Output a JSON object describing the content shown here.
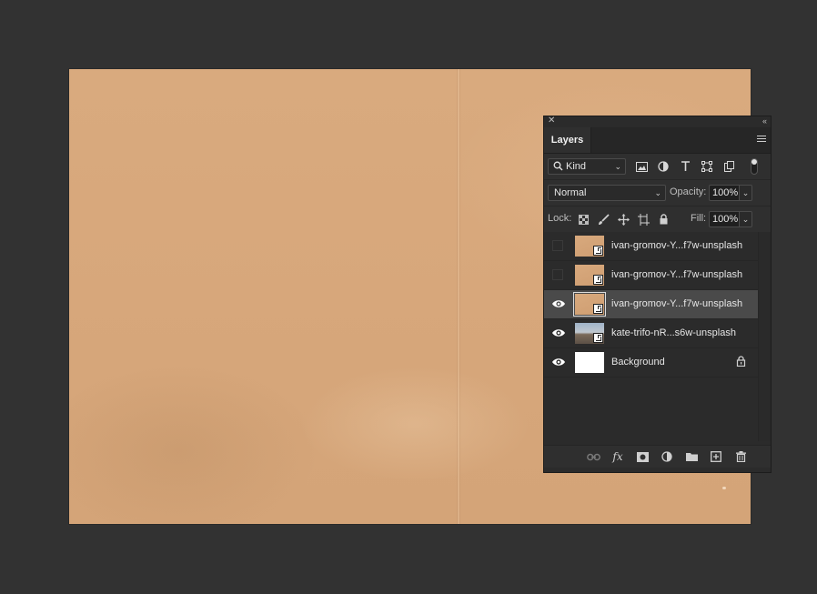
{
  "panel": {
    "title": "Layers",
    "close_glyph": "✕",
    "collapse_glyph": "‹‹",
    "filter": {
      "kind_label": "Kind",
      "icons": [
        "image-filter-icon",
        "adjustment-filter-icon",
        "type-filter-icon",
        "shape-filter-icon",
        "smart-object-filter-icon"
      ]
    },
    "blend_mode": "Normal",
    "opacity_label": "Opacity:",
    "opacity_value": "100%",
    "lock_label": "Lock:",
    "fill_label": "Fill:",
    "fill_value": "100%",
    "layers": [
      {
        "name": "ivan-gromov-Y...f7w-unsplash",
        "visible": false,
        "selected": false,
        "thumb": "paper",
        "smart_object": true,
        "locked": false
      },
      {
        "name": "ivan-gromov-Y...f7w-unsplash",
        "visible": false,
        "selected": false,
        "thumb": "paper",
        "smart_object": true,
        "locked": false
      },
      {
        "name": "ivan-gromov-Y...f7w-unsplash",
        "visible": true,
        "selected": true,
        "thumb": "paper",
        "smart_object": true,
        "locked": false
      },
      {
        "name": "kate-trifo-nR...s6w-unsplash",
        "visible": true,
        "selected": false,
        "thumb": "photo",
        "smart_object": true,
        "locked": false
      },
      {
        "name": "Background",
        "visible": true,
        "selected": false,
        "thumb": "white",
        "smart_object": false,
        "locked": true
      }
    ],
    "fx_label": "fx"
  },
  "colors": {
    "workspace": "#323232",
    "panel": "#2b2b2b",
    "selected_layer": "#4a4a4a",
    "paper": "#d8a97d"
  }
}
